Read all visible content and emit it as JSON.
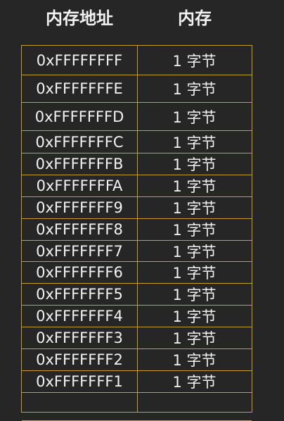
{
  "header": {
    "address_label": "内存地址",
    "memory_label": "内存"
  },
  "rows": [
    {
      "address": "0xFFFFFFFF",
      "size": "1 字节"
    },
    {
      "address": "0xFFFFFFFE",
      "size": "1 字节"
    },
    {
      "address": "0xFFFFFFFD",
      "size": "1 字节"
    },
    {
      "address": "0xFFFFFFFC",
      "size": "1 字节"
    },
    {
      "address": "0xFFFFFFFB",
      "size": "1 字节"
    },
    {
      "address": "0xFFFFFFFA",
      "size": "1 字节"
    },
    {
      "address": "0xFFFFFFF9",
      "size": "1 字节"
    },
    {
      "address": "0xFFFFFFF8",
      "size": "1 字节"
    },
    {
      "address": "0xFFFFFFF7",
      "size": "1 字节"
    },
    {
      "address": "0xFFFFFFF6",
      "size": "1 字节"
    },
    {
      "address": "0xFFFFFFF5",
      "size": "1 字节"
    },
    {
      "address": "0xFFFFFFF4",
      "size": "1 字节"
    },
    {
      "address": "0xFFFFFFF3",
      "size": "1 字节"
    },
    {
      "address": "0xFFFFFFF2",
      "size": "1 字节"
    },
    {
      "address": "0xFFFFFFF1",
      "size": "1 字节"
    },
    {
      "address": "",
      "size": ""
    }
  ],
  "colors": {
    "background": "#262626",
    "border": "#c8a028",
    "text": "#f2f2f2"
  }
}
